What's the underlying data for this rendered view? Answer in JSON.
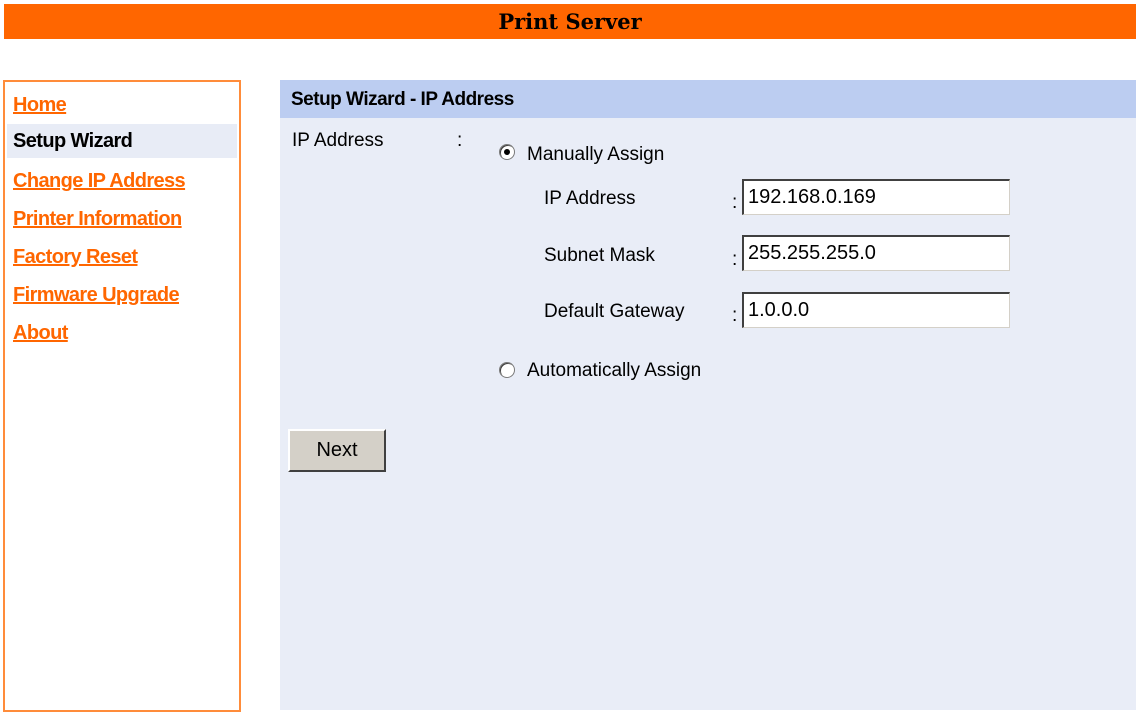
{
  "header": {
    "title": "Print Server"
  },
  "sidebar": {
    "items": [
      {
        "label": "Home",
        "current": false
      },
      {
        "label": "Setup Wizard",
        "current": true
      },
      {
        "label": "Change IP Address",
        "current": false
      },
      {
        "label": "Printer Information",
        "current": false
      },
      {
        "label": "Factory Reset",
        "current": false
      },
      {
        "label": "Firmware Upgrade",
        "current": false
      },
      {
        "label": "About",
        "current": false
      }
    ]
  },
  "main": {
    "title": "Setup Wizard - IP Address",
    "ip_address_label": "IP Address",
    "colon": ":",
    "manual": {
      "label": "Manually Assign",
      "selected": true,
      "fields": {
        "ip": {
          "label": "IP Address",
          "value": "192.168.0.169"
        },
        "subnet": {
          "label": "Subnet Mask",
          "value": "255.255.255.0"
        },
        "gateway": {
          "label": "Default Gateway",
          "value": "1.0.0.0"
        }
      }
    },
    "automatic": {
      "label": "Automatically Assign",
      "selected": false
    },
    "next_label": "Next"
  },
  "colors": {
    "header_bg": "#ff6600",
    "link": "#ff6600",
    "panel_bg": "#e9edf7",
    "panel_title_bg": "#bccdf1",
    "sidebar_border": "#ff8c3a"
  }
}
